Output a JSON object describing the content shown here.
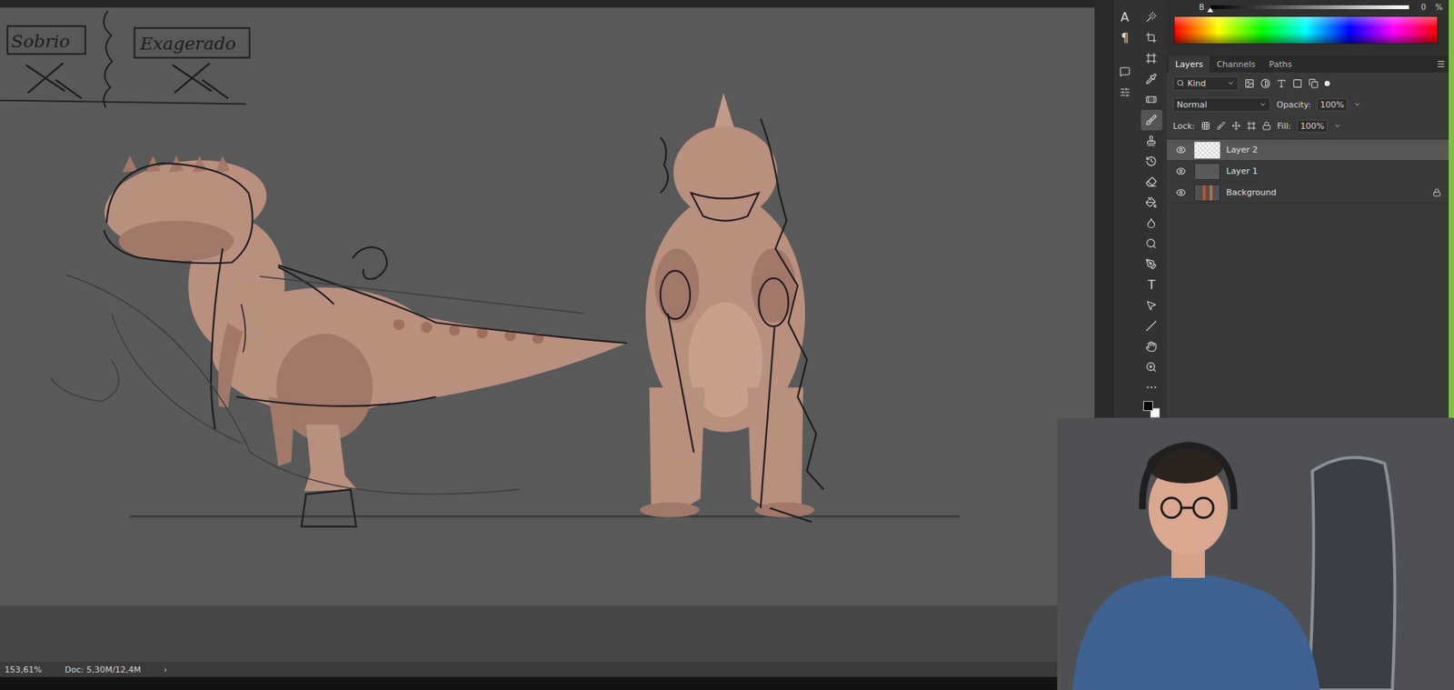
{
  "canvas": {
    "labels": [
      {
        "text": "Sobrio",
        "crossed_out": true
      },
      {
        "text": "Exagerado",
        "crossed_out": true
      }
    ]
  },
  "status_bar": {
    "zoom": "153,61%",
    "document": "Doc: 5,30M/12,4M",
    "arrow": "›"
  },
  "color_panel": {
    "channel": "B",
    "value": "0",
    "unit": "%",
    "level": 0
  },
  "toolbar": {
    "side": [
      {
        "kind": "glyph",
        "text": "A",
        "selected": false
      },
      {
        "kind": "glyph",
        "text": "¶",
        "selected": false
      },
      {
        "kind": "icon",
        "selected": false
      },
      {
        "kind": "icon",
        "selected": false
      }
    ],
    "main": [
      {
        "kind": "icon",
        "selected": false
      },
      {
        "kind": "icon",
        "selected": false
      },
      {
        "kind": "icon",
        "selected": false
      },
      {
        "kind": "icon",
        "selected": false
      },
      {
        "kind": "icon",
        "selected": false
      },
      {
        "kind": "icon",
        "selected": true
      },
      {
        "kind": "icon",
        "selected": false
      },
      {
        "kind": "icon",
        "selected": false
      },
      {
        "kind": "icon",
        "selected": false
      },
      {
        "kind": "icon",
        "selected": false
      },
      {
        "kind": "icon",
        "selected": false
      },
      {
        "kind": "icon",
        "selected": false
      },
      {
        "kind": "icon",
        "selected": false
      },
      {
        "kind": "glyph",
        "text": "T",
        "selected": false
      },
      {
        "kind": "icon",
        "selected": false
      },
      {
        "kind": "icon",
        "selected": false
      },
      {
        "kind": "icon",
        "selected": false
      },
      {
        "kind": "icon",
        "selected": false
      },
      {
        "kind": "glyph",
        "text": "···",
        "selected": false
      }
    ]
  },
  "panel_tabs": [
    {
      "label": "Layers",
      "selected": true
    },
    {
      "label": "Channels",
      "selected": false
    },
    {
      "label": "Paths",
      "selected": false
    }
  ],
  "filter": {
    "label": "Kind"
  },
  "blend_mode": "Normal",
  "opacity": {
    "label": "Opacity:",
    "value": "100%"
  },
  "lock": {
    "label": "Lock:"
  },
  "fill": {
    "label": "Fill:",
    "value": "100%"
  },
  "layers": [
    {
      "name": "Layer 2",
      "selected": true,
      "visible": true,
      "locked": false,
      "kind": "transparent"
    },
    {
      "name": "Layer 1",
      "selected": false,
      "visible": true,
      "locked": false,
      "kind": "fill"
    },
    {
      "name": "Background",
      "selected": false,
      "visible": true,
      "locked": true,
      "kind": "image"
    }
  ]
}
